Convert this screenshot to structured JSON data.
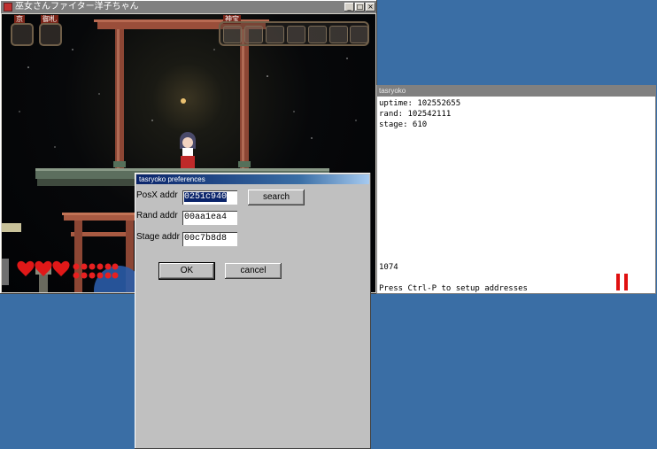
{
  "game_window": {
    "title": "巫女さんファイター洋子ちゃん",
    "buttons": {
      "minimize": "_",
      "maximize": "□",
      "close": "×"
    },
    "hud": {
      "label_left_1": "京",
      "label_left_2": "御札",
      "label_right": "神宝"
    }
  },
  "prefs_dialog": {
    "title": "tasryoko preferences",
    "posx_label": "PosX addr",
    "posx_value": "0251c940",
    "rand_label": "Rand addr",
    "rand_value": "00aa1ea4",
    "stage_label": "Stage addr",
    "stage_value": "00c7b8d8",
    "search_label": "search",
    "ok_label": "OK",
    "cancel_label": "cancel"
  },
  "tas_window": {
    "title": "tasryoko",
    "uptime_line": "uptime: 102552655",
    "rand_line": "rand: 102542111",
    "stage_line": "stage: 610",
    "counter": "1074",
    "hint": "Press Ctrl-P to setup addresses",
    "pause_icon": "pause-icon",
    "accent_color": "#e01010"
  }
}
